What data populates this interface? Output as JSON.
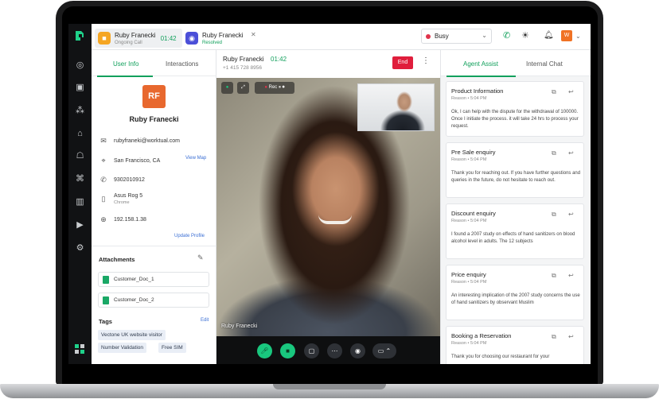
{
  "colors": {
    "accent": "#12a05c",
    "end": "#e01e3c",
    "busy": "#e0344b",
    "avatar": "#e8682e",
    "link": "#3b6fd4"
  },
  "nav": {
    "icons": [
      "logo-icon",
      "dashboard-icon",
      "contacts-icon",
      "network-icon",
      "inbox-icon",
      "robot-icon",
      "analytics-icon",
      "video-icon",
      "settings-icon",
      "apps-icon"
    ]
  },
  "topbar": {
    "tabs": [
      {
        "name": "Ruby Franecki",
        "sub": "Ongoing Call",
        "time": "01:42",
        "icon": "video-call-icon"
      },
      {
        "name": "Ruby Franecki",
        "sub": "Resolved",
        "icon": "chat-icon"
      }
    ],
    "status": "Busy",
    "avatar_letter": "W"
  },
  "user": {
    "tabs": [
      "User Info",
      "Interactions"
    ],
    "initials": "RF",
    "name": "Ruby Franecki",
    "email": "rubyfraneki@worktual.com",
    "location": "San Francisco, CA",
    "view_map": "View Map",
    "phone": "9302010912",
    "device": "Asus Rog 5",
    "browser": "Chrome",
    "ip": "192.158.1.38",
    "update_profile": "Update Profile",
    "attachments_title": "Attachments",
    "attachments": [
      "Customer_Doc_1",
      "Customer_Doc_2"
    ],
    "tags_title": "Tags",
    "tags_edit": "Edit",
    "tags": [
      "Vectone UK website visitor",
      "Number Validation",
      "Free SIM"
    ]
  },
  "call": {
    "name": "Ruby Franecki",
    "time": "01:42",
    "phone": "+1 415 728 8956",
    "end_label": "End",
    "rec_label": "Rec",
    "caller_label": "Ruby Franecki"
  },
  "assist": {
    "tabs": [
      "Agent Assist",
      "Internal Chat"
    ],
    "cards": [
      {
        "title": "Product Information",
        "meta": "Reason • 5:04 PM",
        "body": "Ok, I can help with the dispute for the withdrawal of 100000. Once I initiate the process. it will take 24 hrs  to process your request."
      },
      {
        "title": "Pre Sale enquiry",
        "meta": "Reason • 5:04 PM",
        "body": "Thank you for reaching out. If you have further questions and queries in the future, do not hesitate to reach out."
      },
      {
        "title": "Discount enquiry",
        "meta": "Reason • 5:04 PM",
        "body": "I found a 2007 study on effects of hand sanitizers on blood alcohol level in adults. The 12 subjects"
      },
      {
        "title": "Price enquiry",
        "meta": "Reason • 5:04 PM",
        "body": "An interesting implication of the 2007 study concerns the use of hand sanitizers by observant Muslim"
      },
      {
        "title": "Booking a Reservation",
        "meta": "Reason • 5:04 PM",
        "body": "Thank you for choosing our restaurant for your"
      }
    ]
  }
}
